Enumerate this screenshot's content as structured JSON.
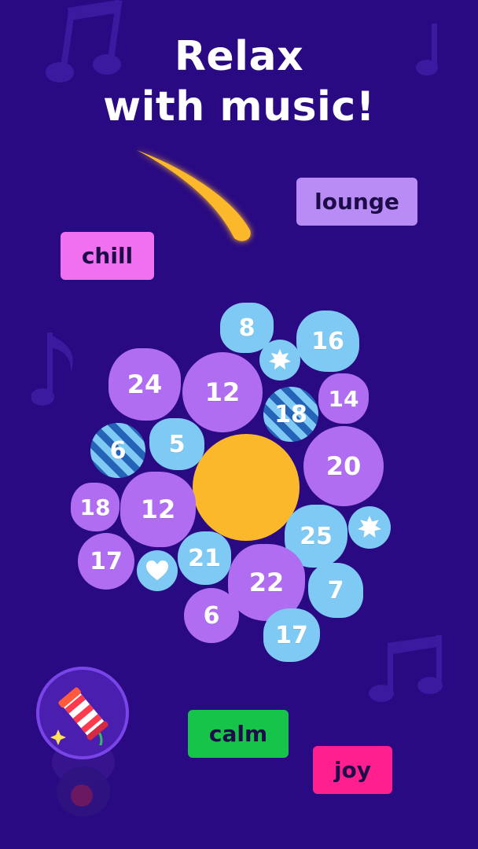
{
  "headline": {
    "line1": "Relax",
    "line2": "with music!"
  },
  "tags": {
    "lounge": "lounge",
    "chill": "chill",
    "calm": "calm",
    "joy": "joy"
  },
  "colors": {
    "background": "#2a0a82",
    "purple_bubble": "#b06df2",
    "blue_bubble": "#7fc9f5",
    "sun": "#fbb82b",
    "tag_lounge": "#b88cf4",
    "tag_chill": "#f070f0",
    "tag_calm": "#16c44a",
    "tag_joy": "#ff1f8e"
  },
  "bubbles": {
    "b8": "8",
    "b16": "16",
    "b24": "24",
    "b12a": "12",
    "b18a": "18",
    "b14": "14",
    "b6a": "6",
    "b5": "5",
    "b20": "20",
    "b18b": "18",
    "b12b": "12",
    "b25": "25",
    "b17a": "17",
    "b21": "21",
    "b22": "22",
    "b7": "7",
    "b6b": "6",
    "b17b": "17"
  },
  "icons": {
    "star_bubble": "star-icon",
    "heart_bubble": "heart-icon",
    "booster": "firecracker-icon"
  }
}
